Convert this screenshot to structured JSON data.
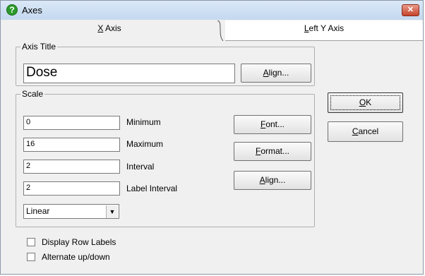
{
  "window": {
    "title": "Axes",
    "close_label": "✕"
  },
  "tabs": [
    {
      "label": "X Axis",
      "mnemonic": "X",
      "rest": " Axis"
    },
    {
      "label": "Left Y Axis",
      "mnemonic": "L",
      "rest": "eft Y Axis"
    }
  ],
  "axis_title": {
    "group_label": "Axis Title",
    "value": "Dose",
    "align_button": {
      "mnemonic": "A",
      "rest": "lign..."
    }
  },
  "scale": {
    "group_label": "Scale",
    "fields": [
      {
        "value": "0",
        "label": "Minimum"
      },
      {
        "value": "16",
        "label": "Maximum"
      },
      {
        "value": "2",
        "label": "Interval"
      },
      {
        "value": "2",
        "label": "Label Interval"
      }
    ],
    "scale_type": "Linear",
    "font_button": {
      "mnemonic": "F",
      "rest": "ont..."
    },
    "format_button": {
      "mnemonic": "F",
      "rest": "ormat..."
    },
    "align_button": {
      "mnemonic": "A",
      "rest": "lign..."
    }
  },
  "buttons": {
    "ok": {
      "mnemonic": "O",
      "rest": "K"
    },
    "cancel": {
      "mnemonic": "C",
      "rest": "ancel"
    }
  },
  "checkboxes": [
    {
      "label": "Display Row Labels",
      "checked": false
    },
    {
      "label": "Alternate up/down",
      "checked": false
    }
  ]
}
